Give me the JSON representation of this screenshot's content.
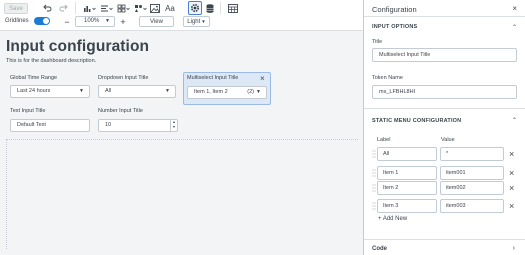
{
  "toolbar": {
    "save_label": "Save",
    "gridlines_label": "Gridlines",
    "zoom_value": "100%",
    "view_label": "View",
    "theme_value": "Light",
    "text_tool_label": "Aa"
  },
  "canvas": {
    "title": "Input configuration",
    "description": "This is for the dashboard description.",
    "inputs": {
      "time_range": {
        "label": "Global Time Range",
        "value": "Last 24 hours"
      },
      "dropdown": {
        "label": "Dropdown Input Title",
        "value": "All"
      },
      "multiselect": {
        "label": "Multiselect Input Title",
        "value": "Item 1, Item 2",
        "count": "(2)"
      },
      "text": {
        "label": "Text Input Title",
        "value": "Default Text"
      },
      "number": {
        "label": "Number Input Title",
        "value": "10"
      }
    }
  },
  "panel": {
    "title": "Configuration",
    "input_options_heading": "INPUT OPTIONS",
    "title_label": "Title",
    "title_value": "Multiselect Input Title",
    "token_label": "Token Name",
    "token_value": "ms_LFBHL8HI",
    "static_heading": "STATIC MENU CONFIGURATION",
    "col_label": "Label",
    "col_value": "Value",
    "rows": [
      {
        "label": "All",
        "value": "*"
      },
      {
        "label": "Item 1",
        "value": "item001"
      },
      {
        "label": "Item 2",
        "value": "item002"
      },
      {
        "label": "Item 3",
        "value": "item003"
      }
    ],
    "add_new": "+ Add New",
    "code_label": "Code"
  }
}
